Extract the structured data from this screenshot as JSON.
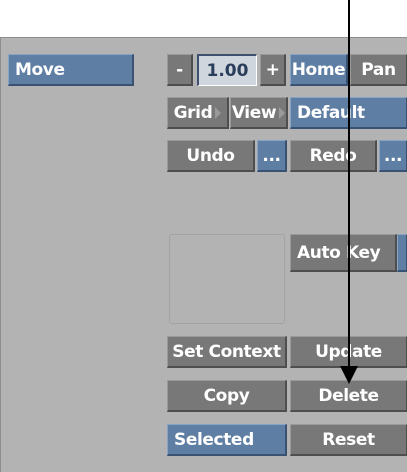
{
  "mode_button": "Move",
  "zoom": {
    "minus": "-",
    "value": "1.00",
    "plus": "+"
  },
  "home": "Home",
  "pan": "Pan",
  "grid": "Grid",
  "view": "View",
  "default": "Default",
  "undo": "Undo",
  "undo_more": "...",
  "redo": "Redo",
  "redo_more": "...",
  "auto_key": "Auto Key",
  "set_context": "Set Context",
  "update": "Update",
  "copy": "Copy",
  "delete": "Delete",
  "selected": "Selected",
  "reset": "Reset",
  "colors": {
    "panel": "#b3b3b3",
    "button": "#787878",
    "blue_button": "#5f7ea3",
    "field": "#cfd6de"
  }
}
